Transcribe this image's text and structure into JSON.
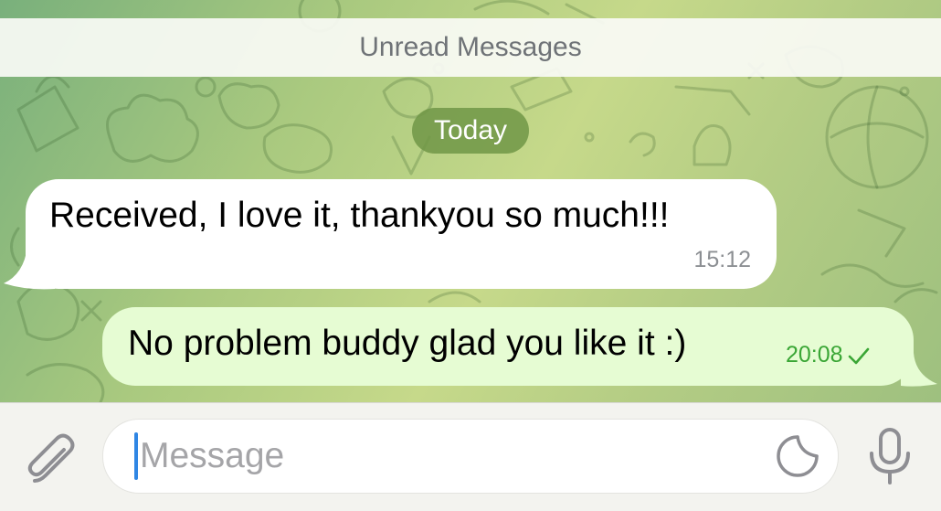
{
  "banner": {
    "unread_label": "Unread Messages"
  },
  "chat": {
    "date_label": "Today",
    "messages": [
      {
        "direction": "incoming",
        "text": "Received, I love it, thankyou so much!!!",
        "time": "15:12"
      },
      {
        "direction": "outgoing",
        "text": "No problem buddy glad you like it :)",
        "time": "20:08",
        "status_icon": "check-icon"
      }
    ]
  },
  "composer": {
    "placeholder": "Message",
    "attach_icon": "paperclip-icon",
    "sticker_icon": "sticker-icon",
    "mic_icon": "microphone-icon"
  },
  "colors": {
    "outgoing_bubble": "#e6fcd3",
    "incoming_bubble": "#ffffff",
    "time_outgoing": "#3aa635",
    "date_pill": "#709646",
    "caret": "#2f86e4"
  }
}
